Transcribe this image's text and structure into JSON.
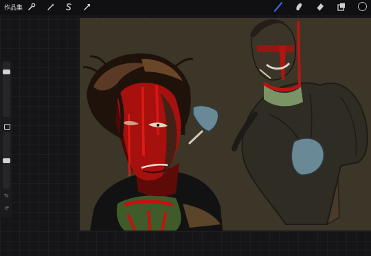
{
  "toolbar": {
    "gallery_label": "作品集",
    "left_tools": [
      "adjustments-wrench-icon",
      "selection-wand-icon",
      "transform-s-icon",
      "actions-arrow-icon"
    ],
    "right_tools": [
      "brush-icon",
      "smudge-icon",
      "eraser-icon",
      "layers-icon",
      "color-swatch"
    ]
  },
  "colors": {
    "canvas_background": "#3b3628",
    "workspace": "#151518",
    "active_tool": "#3b6ff5",
    "current_color": "#0a0a0a",
    "blood_red": "#c4120f",
    "sweater_green": "#7e9a6a"
  },
  "sidebar": {
    "brush_size_level": 0.15,
    "opacity_level": 0.5
  }
}
